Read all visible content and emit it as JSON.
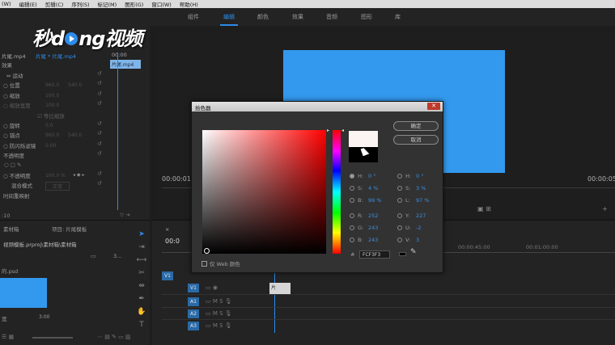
{
  "menubar": {
    "items": [
      "(W)",
      "编辑(E)",
      "剪辑(C)",
      "序列(S)",
      "标记(M)",
      "图形(G)",
      "窗口(W)",
      "帮助(H)"
    ]
  },
  "workspaces": {
    "tabs": [
      "组件",
      "编辑",
      "颜色",
      "效果",
      "音频",
      "图形",
      "库"
    ],
    "active": "编辑"
  },
  "watermark": {
    "part1": "秒d",
    "part2": "ng视频"
  },
  "effect_controls": {
    "clip_tab": "片尾.mp4",
    "seq_tab": "片尾 * 片尾.mp4",
    "timecode": "00:00",
    "section": "效果",
    "mini_clip": "片尾.mp4",
    "rows": [
      {
        "label": "运动",
        "value1": "",
        "value2": ""
      },
      {
        "label": "位置",
        "value1": "960.0",
        "value2": "540.0"
      },
      {
        "label": "缩放",
        "value1": "100.0",
        "value2": ""
      },
      {
        "label": "缩放宽度",
        "value1": "100.0",
        "value2": ""
      },
      {
        "label": "等比缩放",
        "value1": "",
        "value2": ""
      },
      {
        "label": "旋转",
        "value1": "0.0",
        "value2": ""
      },
      {
        "label": "锚点",
        "value1": "960.0",
        "value2": "540.0"
      },
      {
        "label": "防闪烁滤镜",
        "value1": "0.00",
        "value2": ""
      },
      {
        "label": "不透明度",
        "value1": "",
        "value2": ""
      },
      {
        "label": "不透明度",
        "value1": "100.0 %",
        "value2": ""
      },
      {
        "label": "混合模式",
        "value1": "正常",
        "value2": ""
      },
      {
        "label": "时间重映射",
        "value1": "",
        "value2": ""
      }
    ],
    "bottom_timecode": ":10"
  },
  "monitor": {
    "timecode_left": "00:00:01",
    "timecode_right": "00:00:05"
  },
  "project": {
    "tabs": [
      "素材箱",
      "项目: 片尾模板"
    ],
    "path": "视频模板.prproj\\素材箱\\素材箱",
    "file_ext": "的.psd",
    "duration": "3:00",
    "item_label": "宽",
    "count": "3..."
  },
  "timeline": {
    "timecode": "00:0",
    "ruler": [
      "00:00:45:00",
      "00:01:00:00"
    ],
    "tracks": [
      "V1",
      "V1",
      "A1",
      "A2",
      "A3"
    ],
    "clip_label": "片"
  },
  "color_picker": {
    "title": "拾色器",
    "ok": "确定",
    "cancel": "取消",
    "left_fields": [
      {
        "label": "H:",
        "value": "0 °"
      },
      {
        "label": "S:",
        "value": "4 %"
      },
      {
        "label": "B:",
        "value": "99 %"
      },
      {
        "label": "R:",
        "value": "252"
      },
      {
        "label": "G:",
        "value": "243"
      },
      {
        "label": "B:",
        "value": "243"
      }
    ],
    "right_fields": [
      {
        "label": "H:",
        "value": "0 °"
      },
      {
        "label": "S:",
        "value": "3 %"
      },
      {
        "label": "L:",
        "value": "97 %"
      },
      {
        "label": "Y:",
        "value": "227"
      },
      {
        "label": "U:",
        "value": "-2"
      },
      {
        "label": "V:",
        "value": "3"
      }
    ],
    "hex_label": "#",
    "hex": "FCF3F3",
    "web_only": "仅 Web 颜色",
    "new_color": "#fcf3f3",
    "old_color": "#000000"
  },
  "colors": {
    "accent": "#2d8ceb",
    "frame_blue": "#3399ee"
  }
}
